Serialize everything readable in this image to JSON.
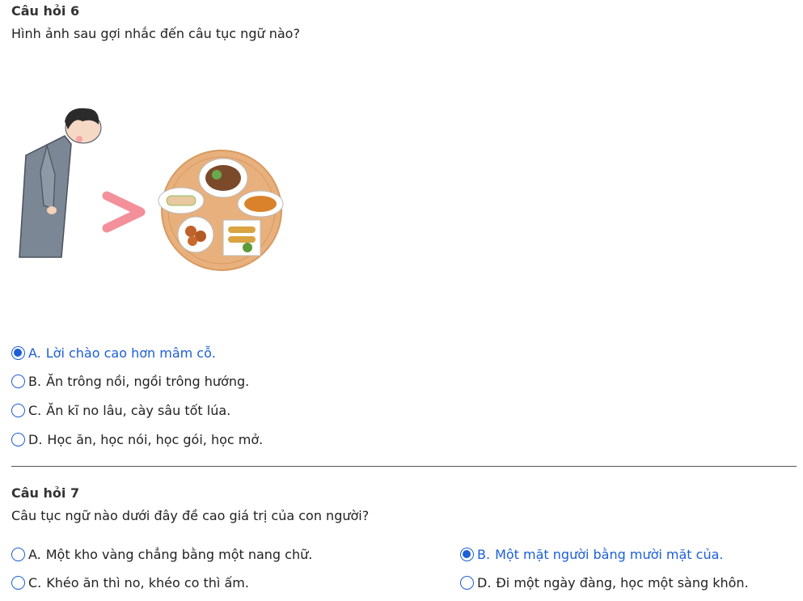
{
  "q6": {
    "title": "Câu hỏi 6",
    "question": "Hình ảnh sau gợi nhắc đến câu tục ngữ nào?",
    "image_icon": "person-bowing-to-food-tray-illustration",
    "selected_index": 0,
    "options": [
      {
        "letter": "A.",
        "text": "Lời chào cao hơn mâm cỗ."
      },
      {
        "letter": "B.",
        "text": "Ăn trông nồi, ngồi trông hướng."
      },
      {
        "letter": "C.",
        "text": "Ăn kĩ no lâu, cày sâu tốt lúa."
      },
      {
        "letter": "D.",
        "text": "Học ăn, học nói, học gói, học mở."
      }
    ]
  },
  "q7": {
    "title": "Câu hỏi 7",
    "question": "Câu tục ngữ nào dưới đây đề cao giá trị của con người?",
    "selected_index": 1,
    "options": [
      {
        "letter": "A.",
        "text": "Một kho vàng chẳng bằng một nang chữ."
      },
      {
        "letter": "B.",
        "text": "Một mặt người bằng mười mặt của."
      },
      {
        "letter": "C.",
        "text": "Khéo ăn thì no, khéo co thì ấm."
      },
      {
        "letter": "D.",
        "text": "Đi một ngày đàng, học một sàng khôn."
      }
    ]
  },
  "colors": {
    "accent": "#1d5fd6",
    "greater_than_sign": "#f4909a",
    "tray": "#e8b07c"
  }
}
